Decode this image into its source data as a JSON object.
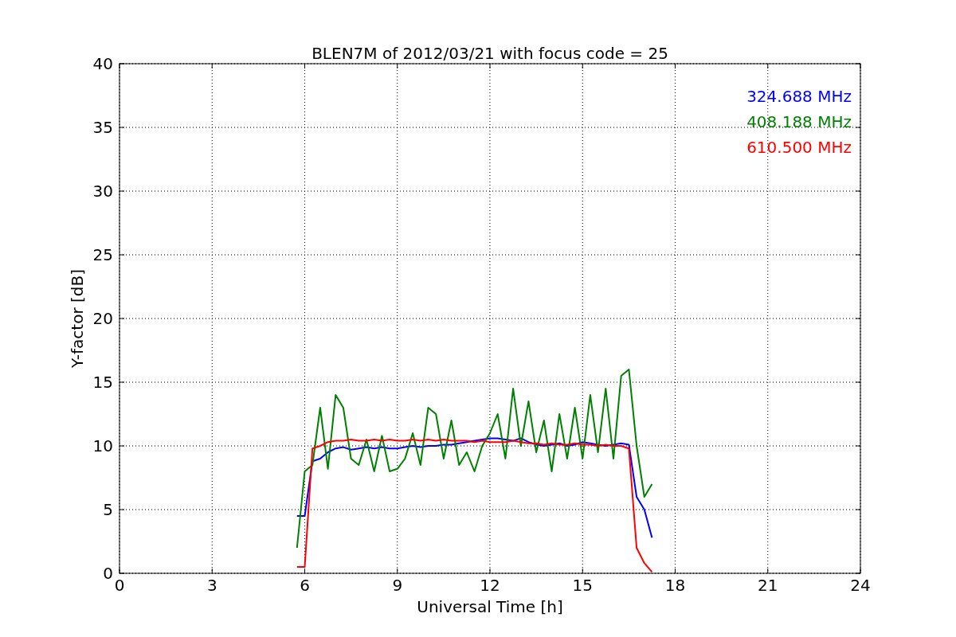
{
  "figure": {
    "chart_data": {
      "type": "line",
      "title": "BLEN7M of 2012/03/21 with focus code = 25",
      "xlabel": "Universal Time [h]",
      "ylabel": "Y-factor [dB]",
      "grid": true,
      "xlim": [
        0,
        24
      ],
      "ylim": [
        0,
        40
      ],
      "xticks": [
        0,
        3,
        6,
        9,
        12,
        15,
        18,
        21,
        24
      ],
      "yticks": [
        0,
        5,
        10,
        15,
        20,
        25,
        30,
        35,
        40
      ],
      "x": [
        5.75,
        6,
        6.25,
        6.5,
        6.75,
        7,
        7.25,
        7.5,
        7.75,
        8,
        8.25,
        8.5,
        8.75,
        9,
        9.25,
        9.5,
        9.75,
        10,
        10.25,
        10.5,
        10.75,
        11,
        11.25,
        11.5,
        11.75,
        12,
        12.25,
        12.5,
        12.75,
        13,
        13.25,
        13.5,
        13.75,
        14,
        14.25,
        14.5,
        14.75,
        15,
        15.25,
        15.5,
        15.75,
        16,
        16.25,
        16.5,
        16.75,
        17,
        17.25
      ],
      "series": [
        {
          "name": "324.688 MHz",
          "color": "#0000ff",
          "values": [
            4.5,
            4.5,
            8.8,
            9.0,
            9.5,
            9.8,
            9.9,
            9.7,
            9.8,
            9.9,
            9.8,
            9.9,
            9.8,
            9.8,
            9.9,
            10.0,
            9.9,
            10.0,
            10.0,
            10.1,
            10.1,
            10.2,
            10.3,
            10.4,
            10.5,
            10.6,
            10.6,
            10.5,
            10.4,
            10.6,
            10.3,
            10.1,
            10.0,
            10.1,
            10.2,
            10.0,
            10.1,
            10.3,
            10.2,
            10.1,
            10.0,
            10.1,
            10.2,
            10.1,
            6.0,
            5.0,
            2.8
          ]
        },
        {
          "name": "408.188 MHz",
          "color": "#008000",
          "values": [
            2.0,
            8.0,
            8.5,
            13.0,
            8.2,
            14.0,
            13.0,
            9.0,
            8.5,
            10.5,
            8.0,
            10.8,
            8.0,
            8.2,
            9.0,
            11.0,
            8.5,
            13.0,
            12.5,
            9.0,
            12.0,
            8.5,
            9.5,
            8.0,
            10.0,
            11.0,
            12.5,
            9.0,
            14.5,
            10.0,
            13.5,
            9.5,
            12.0,
            8.0,
            12.5,
            9.0,
            13.0,
            9.0,
            14.0,
            9.5,
            14.5,
            9.0,
            15.5,
            16.0,
            10.0,
            6.0,
            7.0
          ]
        },
        {
          "name": "610.500 MHz",
          "color": "#ff0000",
          "values": [
            0.5,
            0.5,
            9.8,
            10.0,
            10.3,
            10.4,
            10.4,
            10.5,
            10.4,
            10.4,
            10.5,
            10.4,
            10.5,
            10.4,
            10.4,
            10.5,
            10.4,
            10.5,
            10.4,
            10.5,
            10.4,
            10.4,
            10.4,
            10.3,
            10.4,
            10.3,
            10.3,
            10.3,
            10.4,
            10.3,
            10.2,
            10.2,
            10.1,
            10.2,
            10.1,
            10.1,
            10.2,
            10.1,
            10.1,
            10.0,
            10.1,
            10.0,
            10.0,
            9.8,
            2.0,
            0.8,
            0.1
          ]
        }
      ]
    }
  }
}
